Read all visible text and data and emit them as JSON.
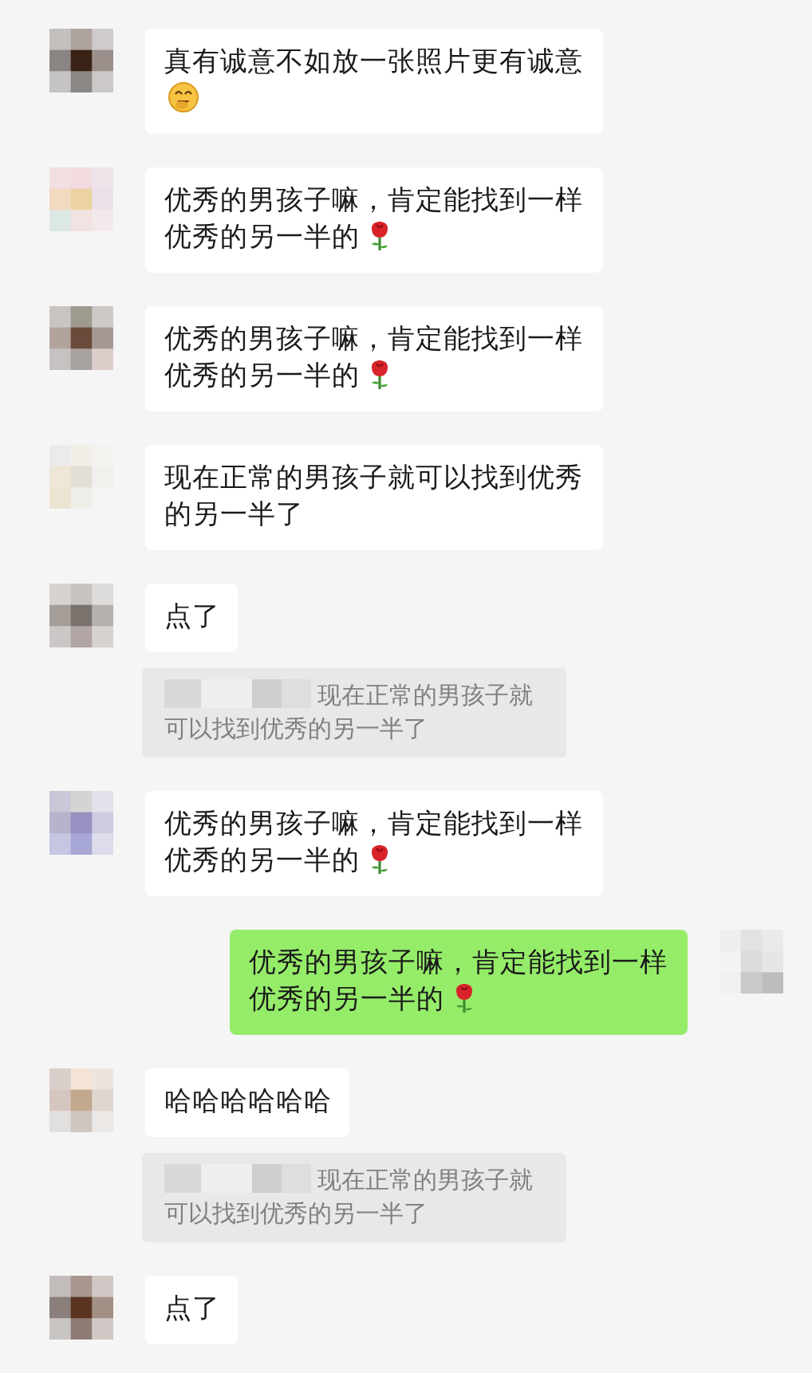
{
  "messages": [
    {
      "kind": "received",
      "text": "真有诚意不如放一张照片更有诚意"
    },
    {
      "kind": "received",
      "text": "优秀的男孩子嘛，肯定能找到一样优秀的另一半的"
    },
    {
      "kind": "received",
      "text": "优秀的男孩子嘛，肯定能找到一样优秀的另一半的"
    },
    {
      "kind": "received",
      "text": "现在正常的男孩子就可以找到优秀的另一半了"
    },
    {
      "kind": "received",
      "text": "点了"
    },
    {
      "kind": "quote",
      "text": "现在正常的男孩子就可以找到优秀的另一半了"
    },
    {
      "kind": "received",
      "text": "优秀的男孩子嘛，肯定能找到一样优秀的另一半的"
    },
    {
      "kind": "sent",
      "text": "优秀的男孩子嘛，肯定能找到一样优秀的另一半的"
    },
    {
      "kind": "received",
      "text": "哈哈哈哈哈哈"
    },
    {
      "kind": "quote",
      "text": "现在正常的男孩子就可以找到优秀的另一半了"
    },
    {
      "kind": "received",
      "text": "点了"
    }
  ]
}
